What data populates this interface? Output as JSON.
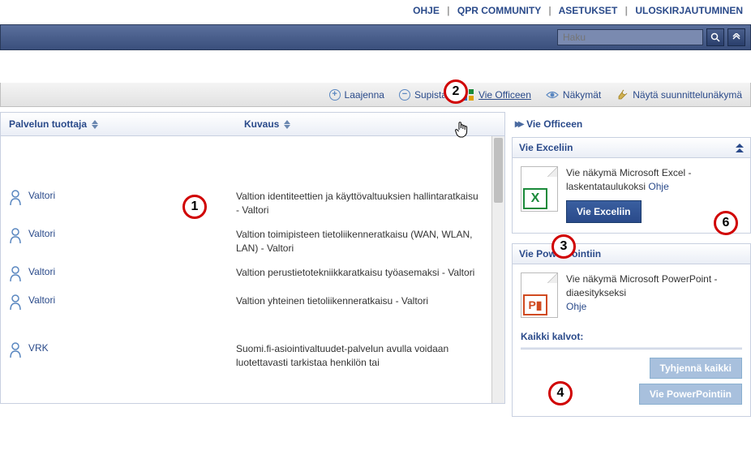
{
  "topLinks": {
    "help": "OHJE",
    "community": "QPR COMMUNITY",
    "settings": "ASETUKSET",
    "logout": "ULOSKIRJAUTUMINEN"
  },
  "search": {
    "placeholder": "Haku"
  },
  "toolbar": {
    "expand": "Laajenna",
    "collapse": "Supista",
    "officeExport": "Vie Officeen",
    "views": "Näkymät",
    "designView": "Näytä suunnittelunäkymä"
  },
  "grid": {
    "columns": {
      "producer": "Palvelun tuottaja",
      "description": "Kuvaus"
    },
    "rows": [
      {
        "producer": "Valtori",
        "description": "Valtion identiteettien ja käyttövaltuuksien hallintaratkaisu - Valtori"
      },
      {
        "producer": "Valtori",
        "description": "Valtion toimipisteen tietoliikenneratkaisu (WAN, WLAN, LAN) - Valtori"
      },
      {
        "producer": "Valtori",
        "description": "Valtion perustietotekniikkaratkaisu työasemaksi - Valtori"
      },
      {
        "producer": "Valtori",
        "description": "Valtion yhteinen tietoliikenneratkaisu - Valtori"
      },
      {
        "producer": "VRK",
        "description": "Suomi.fi-asiointivaltuudet-palvelun avulla voidaan luotettavasti tarkistaa henkilön tai"
      }
    ]
  },
  "rightPanel": {
    "title": "Vie Officeen",
    "excel": {
      "heading": "Vie Exceliin",
      "text": "Vie näkymä Microsoft Excel -laskentataulukoksi ",
      "helpLink": "Ohje",
      "button": "Vie Exceliin"
    },
    "ppt": {
      "heading": "Vie PowerPointiin",
      "text": "Vie näkymä Microsoft PowerPoint -diaesitykseksi",
      "helpLink": "Ohje",
      "allSlides": "Kaikki kalvot:",
      "clearBtn": "Tyhjennä kaikki",
      "exportBtn": "Vie PowerPointiin"
    }
  },
  "annotations": [
    "1",
    "2",
    "3",
    "4",
    "6"
  ]
}
